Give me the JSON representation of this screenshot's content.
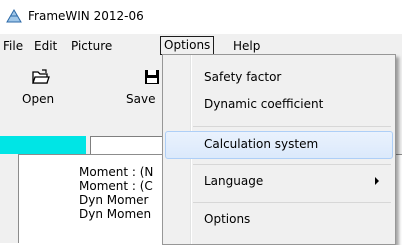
{
  "window": {
    "title": "FrameWIN 2012-06"
  },
  "menubar": {
    "items": [
      {
        "label": "File"
      },
      {
        "label": "Edit"
      },
      {
        "label": "Picture"
      },
      {
        "label": "Options"
      },
      {
        "label": "Help"
      }
    ]
  },
  "toolbar": {
    "open_label": "Open",
    "save_label": "Save"
  },
  "list": {
    "lines": [
      "Moment : (N",
      "Moment : (C",
      "Dyn Momer",
      "Dyn Momen"
    ]
  },
  "options_menu": {
    "items": [
      {
        "label": "Safety factor"
      },
      {
        "label": "Dynamic coefficient"
      },
      {
        "label": "Calculation system"
      },
      {
        "label": "Language"
      },
      {
        "label": "Options"
      }
    ]
  },
  "colors": {
    "highlight_bg": "#dbe9fb",
    "highlight_border": "#aecff7",
    "cyan_bar": "#00e5e5"
  }
}
